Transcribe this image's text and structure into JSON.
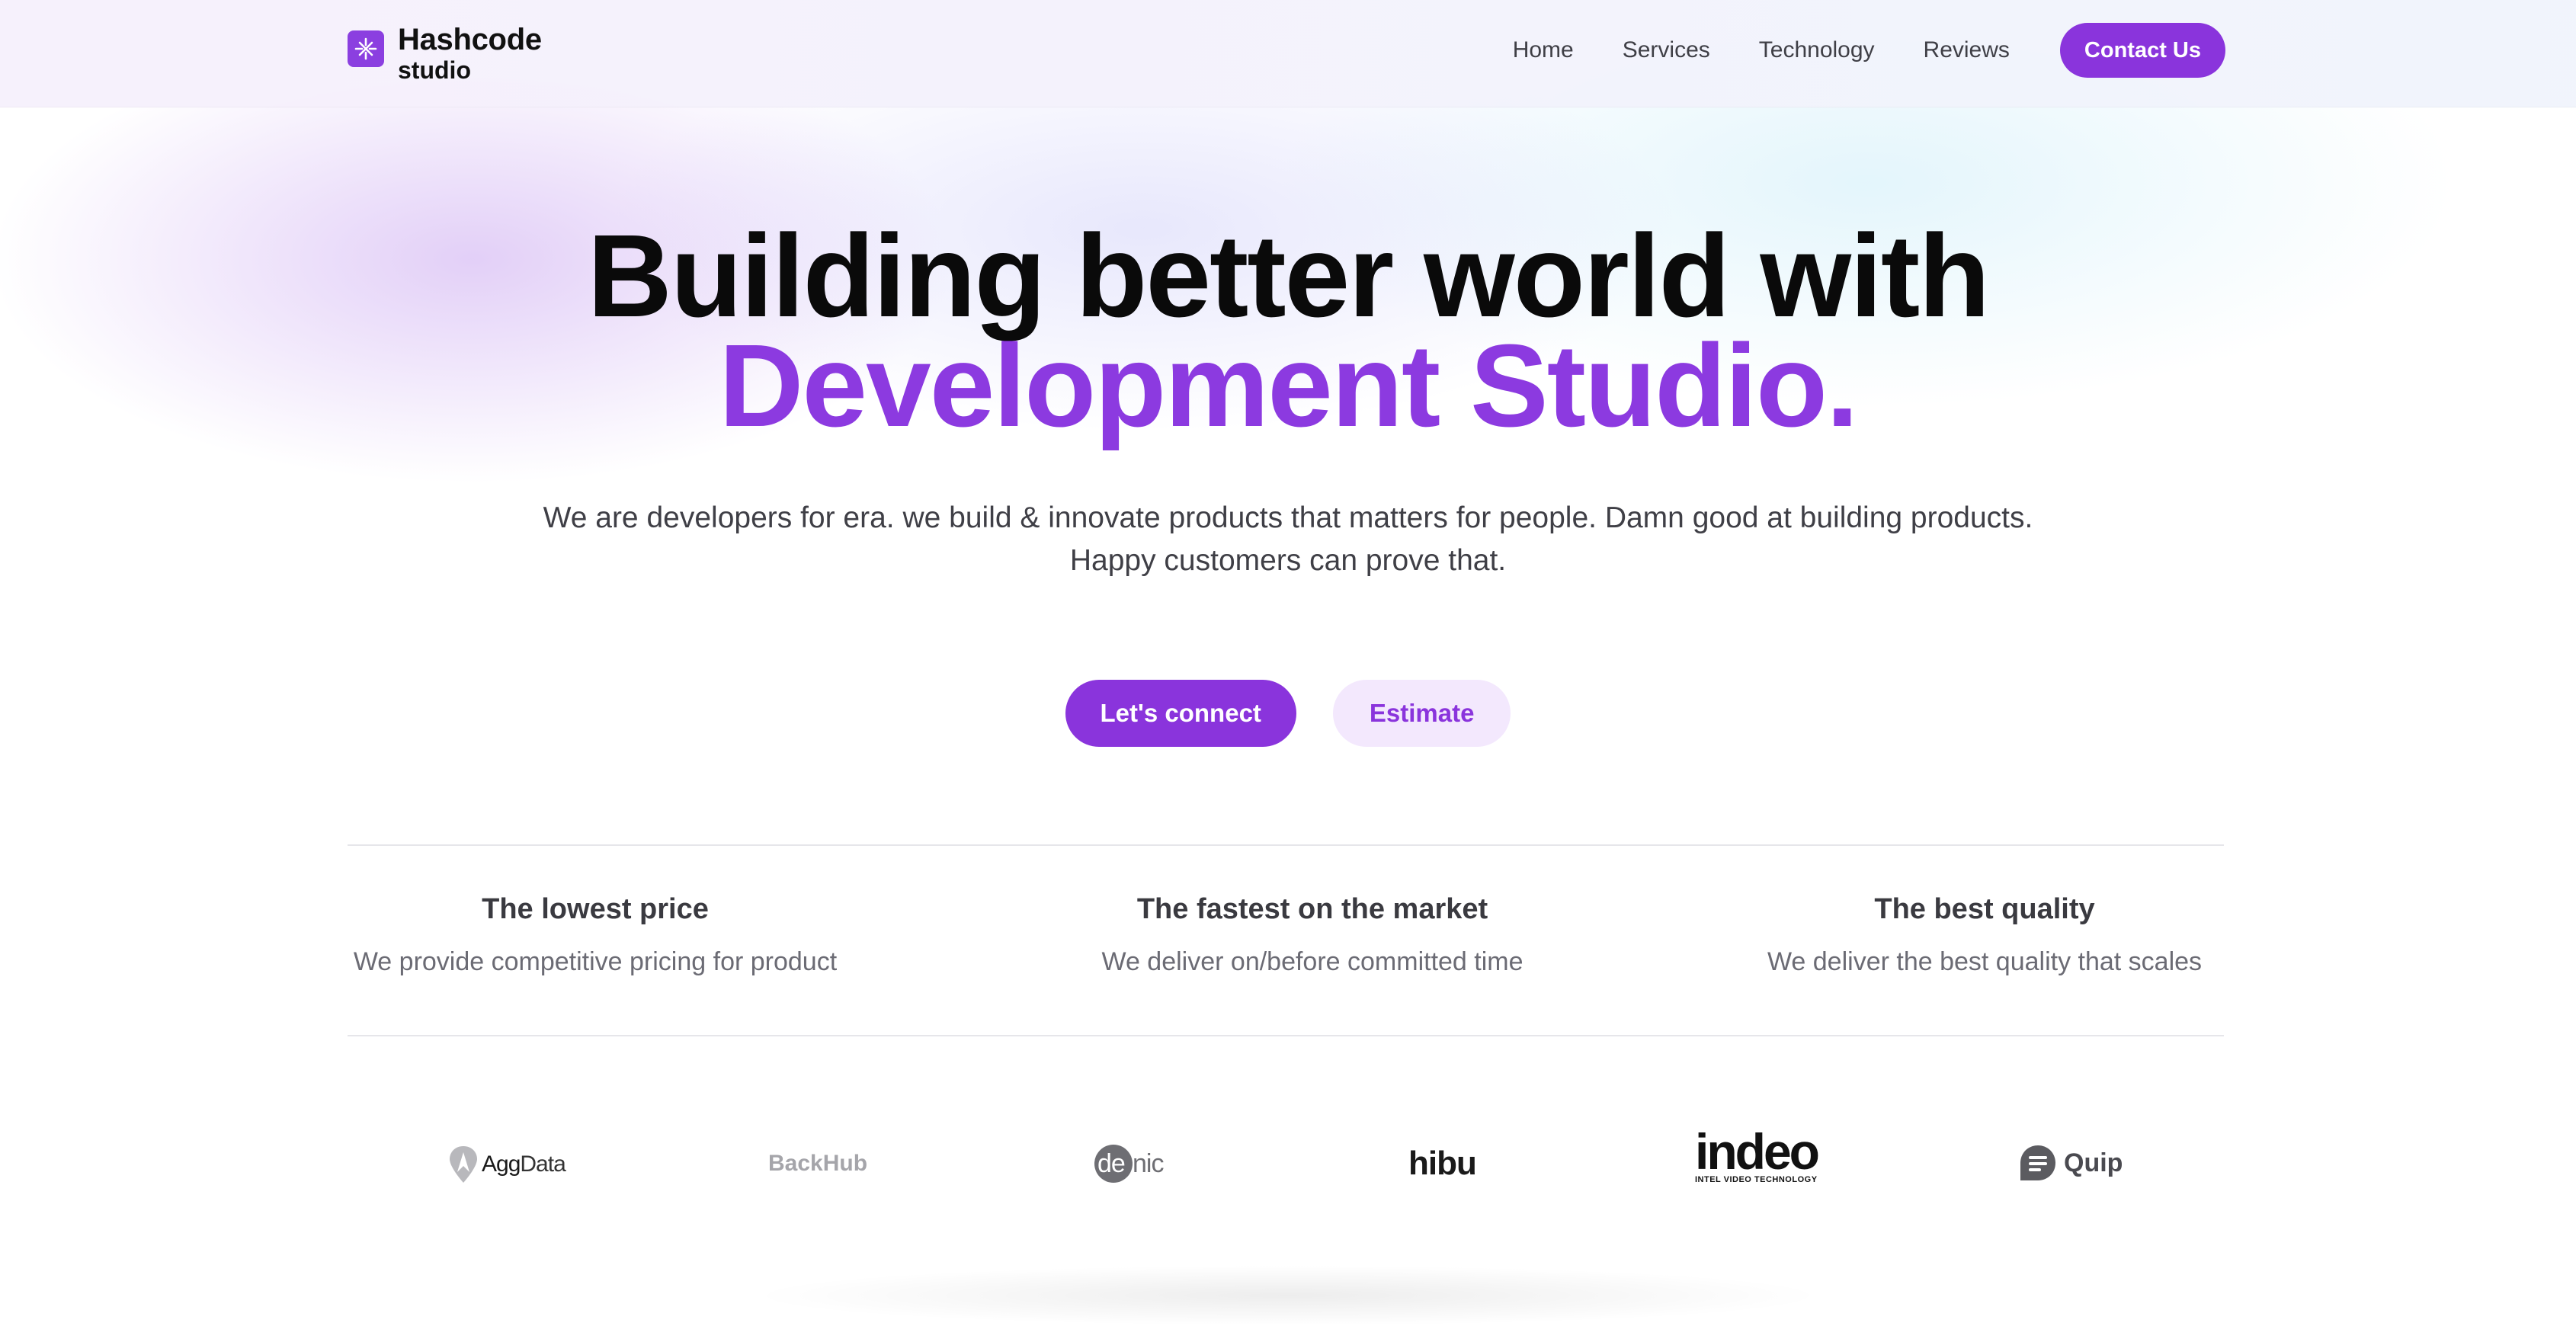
{
  "header": {
    "logo": {
      "line1": "Hashcode",
      "line2": "studio",
      "icon": "logo-cross-icon"
    },
    "nav": [
      "Home",
      "Services",
      "Technology",
      "Reviews"
    ],
    "contact_label": "Contact Us"
  },
  "hero": {
    "title_line1": "Building better world with",
    "title_line2": "Development Studio.",
    "subtitle_line1": "We are developers for era. we build & innovate products that matters for people. Damn good at building products.",
    "subtitle_line2": "Happy customers can prove that.",
    "primary_cta": "Let's connect",
    "secondary_cta": "Estimate"
  },
  "features": [
    {
      "title": "The lowest price",
      "desc": "We provide competitive pricing for product"
    },
    {
      "title": "The fastest on the market",
      "desc": "We deliver on/before committed time"
    },
    {
      "title": "The best quality",
      "desc": "We deliver the best quality that scales"
    }
  ],
  "brands": {
    "aggdata": {
      "a": "Agg",
      "b": "Data"
    },
    "backhub": "BackHub",
    "denic": {
      "a": "de",
      "b": "nic"
    },
    "hibu": "hibu",
    "indeo": {
      "name": "indeo",
      "tagline": "INTEL VIDEO TECHNOLOGY"
    },
    "quip": "Quip"
  },
  "colors": {
    "accent": "#8a34dc",
    "accent_light": "#f3e8fd",
    "heading": "#0a0a0a",
    "body_text": "#3f3f46",
    "muted_text": "#6b6b74"
  }
}
